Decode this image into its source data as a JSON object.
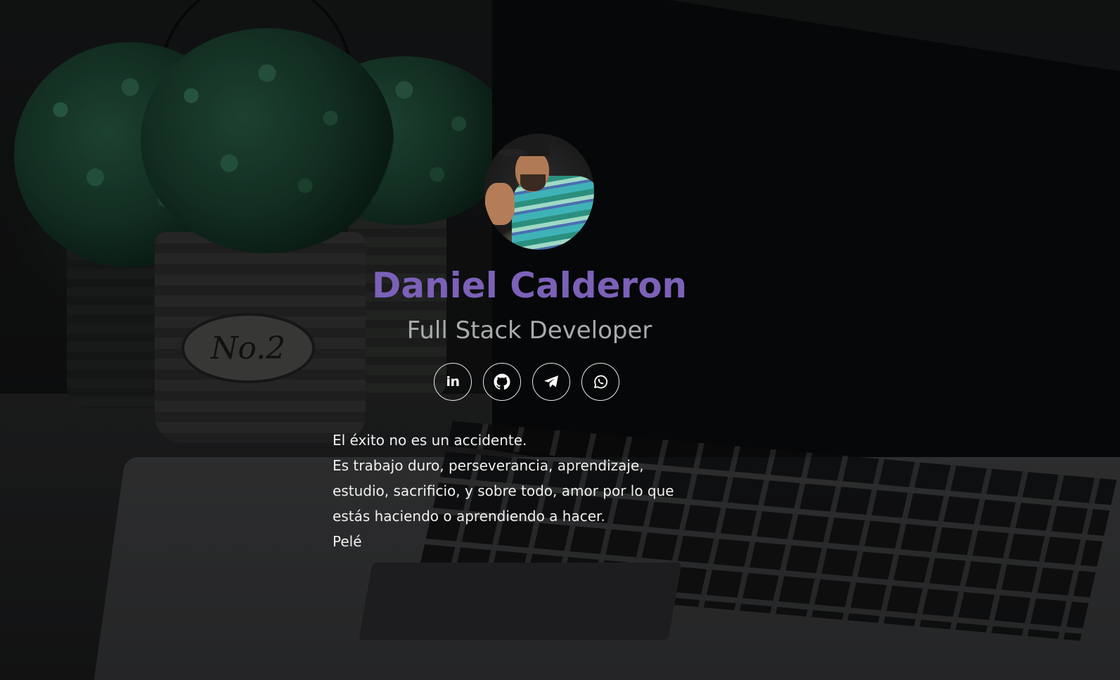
{
  "profile": {
    "name": "Daniel Calderon",
    "title": "Full Stack Developer"
  },
  "socials": [
    {
      "id": "linkedin",
      "label": "in",
      "icon": "linkedin-icon"
    },
    {
      "id": "github",
      "icon": "github-icon"
    },
    {
      "id": "telegram",
      "icon": "telegram-icon"
    },
    {
      "id": "whatsapp",
      "icon": "whatsapp-icon"
    }
  ],
  "quote": {
    "lines": [
      "El éxito no es un accidente.",
      "Es trabajo duro, perseverancia, aprendizaje,",
      "estudio, sacrificio, y sobre todo, amor por lo que",
      "estás haciendo o aprendiendo a hacer.",
      "Pelé"
    ]
  },
  "background": {
    "pot_label": "No.2"
  },
  "colors": {
    "name": "#7b61b8",
    "title": "#a9aaab",
    "text": "#f1f1f1",
    "icon_border": "#e9e9e9"
  }
}
